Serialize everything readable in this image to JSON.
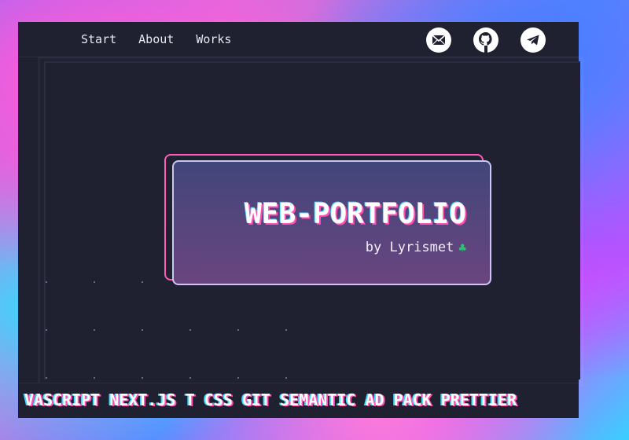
{
  "nav": {
    "links": [
      "Start",
      "About",
      "Works"
    ],
    "icons": [
      "mail-icon",
      "github-icon",
      "telegram-icon"
    ]
  },
  "hero": {
    "title": "WEB-PORTFOLIO",
    "byline": "by Lyrismet",
    "byline_icon": "clover-icon"
  },
  "marquee": {
    "text": "VASCRIPT NEXT.JS T  CSS GIT SEMANTIC AD  PACK PRETTIER"
  },
  "colors": {
    "accent_pink": "#ff4fb0",
    "accent_cyan": "#3fd6ff",
    "frame_bg": "#1f2130",
    "clover_green": "#26c96a"
  }
}
